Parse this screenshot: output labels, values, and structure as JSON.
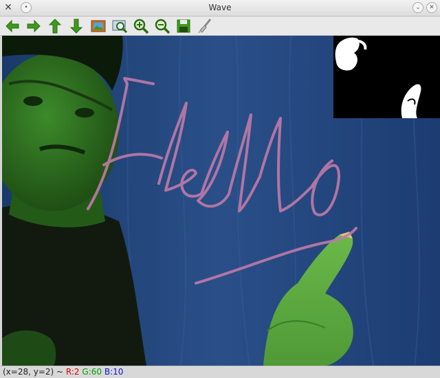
{
  "window": {
    "title": "Wave"
  },
  "toolbar": {
    "tools": [
      {
        "name": "pan-left",
        "icon": "arrow-left-icon"
      },
      {
        "name": "pan-right",
        "icon": "arrow-right-icon"
      },
      {
        "name": "pan-up",
        "icon": "arrow-up-icon"
      },
      {
        "name": "pan-down",
        "icon": "arrow-down-icon"
      },
      {
        "name": "zoom-original",
        "icon": "image-icon"
      },
      {
        "name": "zoom-fit",
        "icon": "zoom-fit-icon"
      },
      {
        "name": "zoom-in",
        "icon": "zoom-in-icon"
      },
      {
        "name": "zoom-out",
        "icon": "zoom-out-icon"
      },
      {
        "name": "save",
        "icon": "save-icon"
      },
      {
        "name": "properties",
        "icon": "brush-icon"
      }
    ]
  },
  "colors": {
    "tool_green": "#3d9a1e",
    "stroke": "#c07aa8",
    "red": "#e00000",
    "green": "#00a000",
    "blue": "#1010d0"
  },
  "status": {
    "coords": "(x=28, y=2) ~",
    "r": "R:2",
    "g": "G:60",
    "b": "B:10"
  }
}
